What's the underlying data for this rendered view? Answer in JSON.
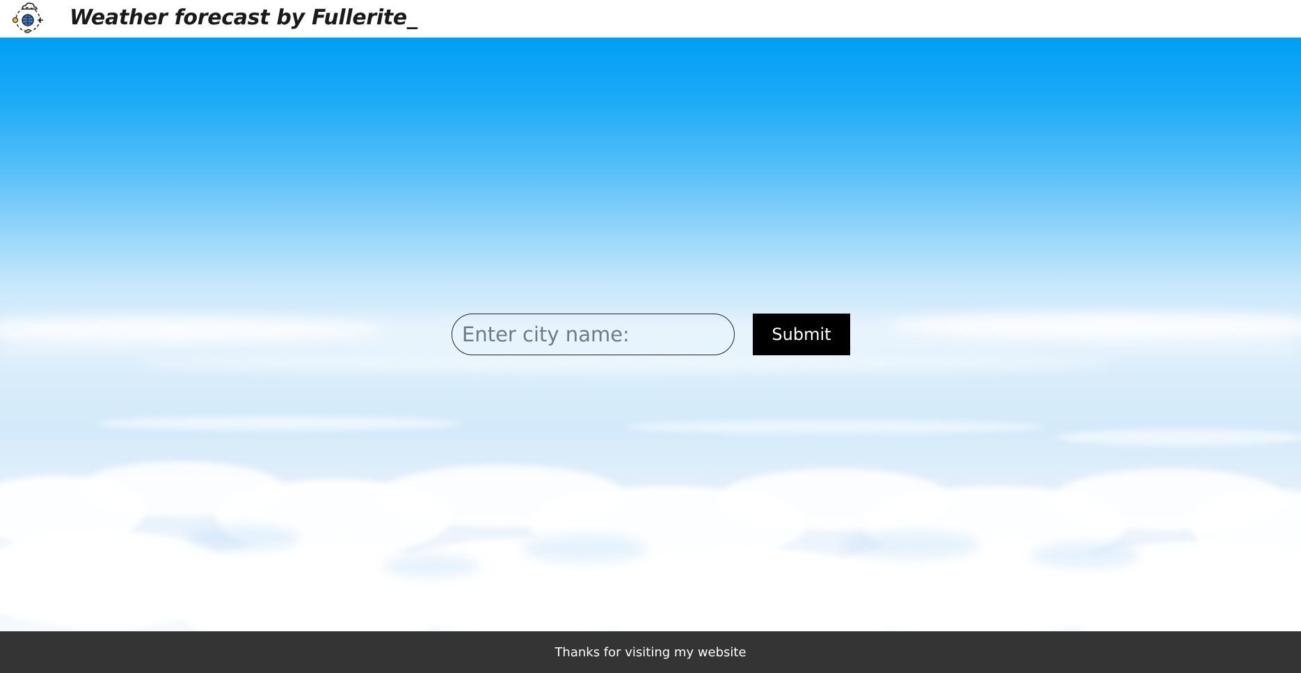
{
  "header": {
    "title": "Weather forecast by Fullerite_",
    "logo_icon": "globe-weather-icon"
  },
  "search": {
    "placeholder": "Enter city name:",
    "value": "",
    "submit_label": "Submit"
  },
  "footer": {
    "text": "Thanks for visiting my website"
  },
  "colors": {
    "sky_top": "#009ef5",
    "sky_bottom": "#f6f9fe",
    "button_bg": "#000000",
    "footer_bg": "#343434"
  }
}
